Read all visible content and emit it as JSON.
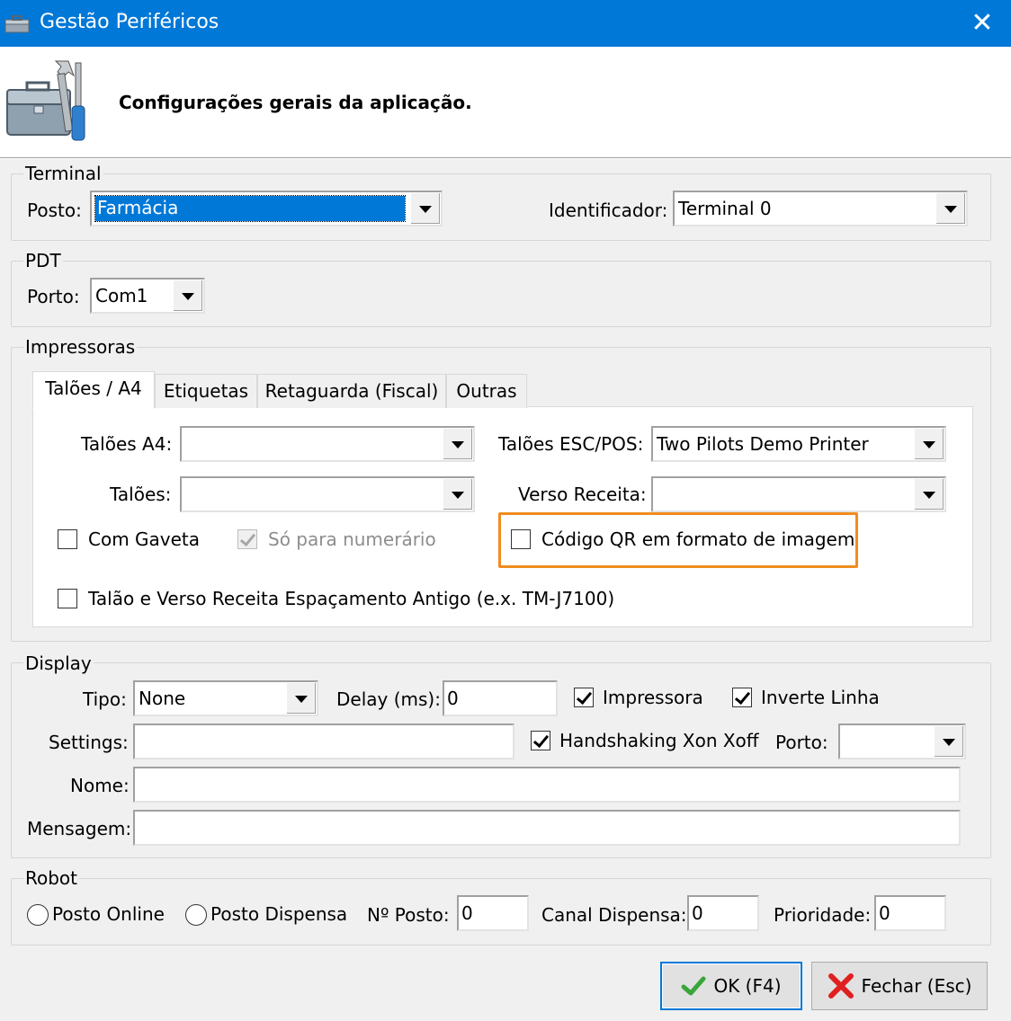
{
  "window": {
    "title": "Gestão Periféricos",
    "close_label": "✕"
  },
  "header": {
    "heading": "Configurações gerais da aplicação."
  },
  "terminal": {
    "group_label": "Terminal",
    "posto_label": "Posto:",
    "posto_value": "Farmácia",
    "identificador_label": "Identificador:",
    "identificador_value": "Terminal 0"
  },
  "pdt": {
    "group_label": "PDT",
    "porto_label": "Porto:",
    "porto_value": "Com1"
  },
  "impressoras": {
    "group_label": "Impressoras",
    "tabs": [
      {
        "label": "Talões / A4",
        "active": true
      },
      {
        "label": "Etiquetas",
        "active": false
      },
      {
        "label": "Retaguarda (Fiscal)",
        "active": false
      },
      {
        "label": "Outras",
        "active": false
      }
    ],
    "taloes_a4_label": "Talões A4:",
    "taloes_a4_value": "",
    "taloes_escpos_label": "Talões ESC/POS:",
    "taloes_escpos_value": "Two Pilots Demo Printer",
    "taloes_label": "Talões:",
    "taloes_value": "",
    "verso_receita_label": "Verso Receita:",
    "verso_receita_value": "",
    "com_gaveta_label": "Com Gaveta",
    "com_gaveta_checked": false,
    "so_numerario_label": "Só para numerário",
    "so_numerario_checked": true,
    "so_numerario_enabled": false,
    "codigo_qr_label": "Código QR em formato de imagem",
    "codigo_qr_checked": false,
    "espacamento_label": "Talão e Verso Receita Espaçamento Antigo (e.x. TM-J7100)",
    "espacamento_checked": false,
    "highlight_color": "#f08c1e"
  },
  "display": {
    "group_label": "Display",
    "tipo_label": "Tipo:",
    "tipo_value": "None",
    "delay_label": "Delay (ms):",
    "delay_value": "0",
    "impressora_label": "Impressora",
    "impressora_checked": true,
    "inverte_linha_label": "Inverte Linha",
    "inverte_linha_checked": true,
    "settings_label": "Settings:",
    "settings_value": "",
    "handshaking_label": "Handshaking Xon Xoff",
    "handshaking_checked": true,
    "porto_label": "Porto:",
    "porto_value": "",
    "nome_label": "Nome:",
    "nome_value": "",
    "mensagem_label": "Mensagem:",
    "mensagem_value": ""
  },
  "robot": {
    "group_label": "Robot",
    "posto_online_label": "Posto Online",
    "posto_dispensa_label": "Posto Dispensa",
    "n_posto_label": "Nº Posto:",
    "n_posto_value": "0",
    "canal_dispensa_label": "Canal Dispensa:",
    "canal_dispensa_value": "0",
    "prioridade_label": "Prioridade:",
    "prioridade_value": "0"
  },
  "buttons": {
    "ok_label": "OK (F4)",
    "ok_icon": "check-icon",
    "fechar_label": "Fechar (Esc)",
    "fechar_icon": "red-x-icon"
  },
  "colors": {
    "titlebar": "#0078d7",
    "selection": "#0078d7",
    "check_green": "#3aa53a",
    "cancel_red": "#e02020"
  }
}
